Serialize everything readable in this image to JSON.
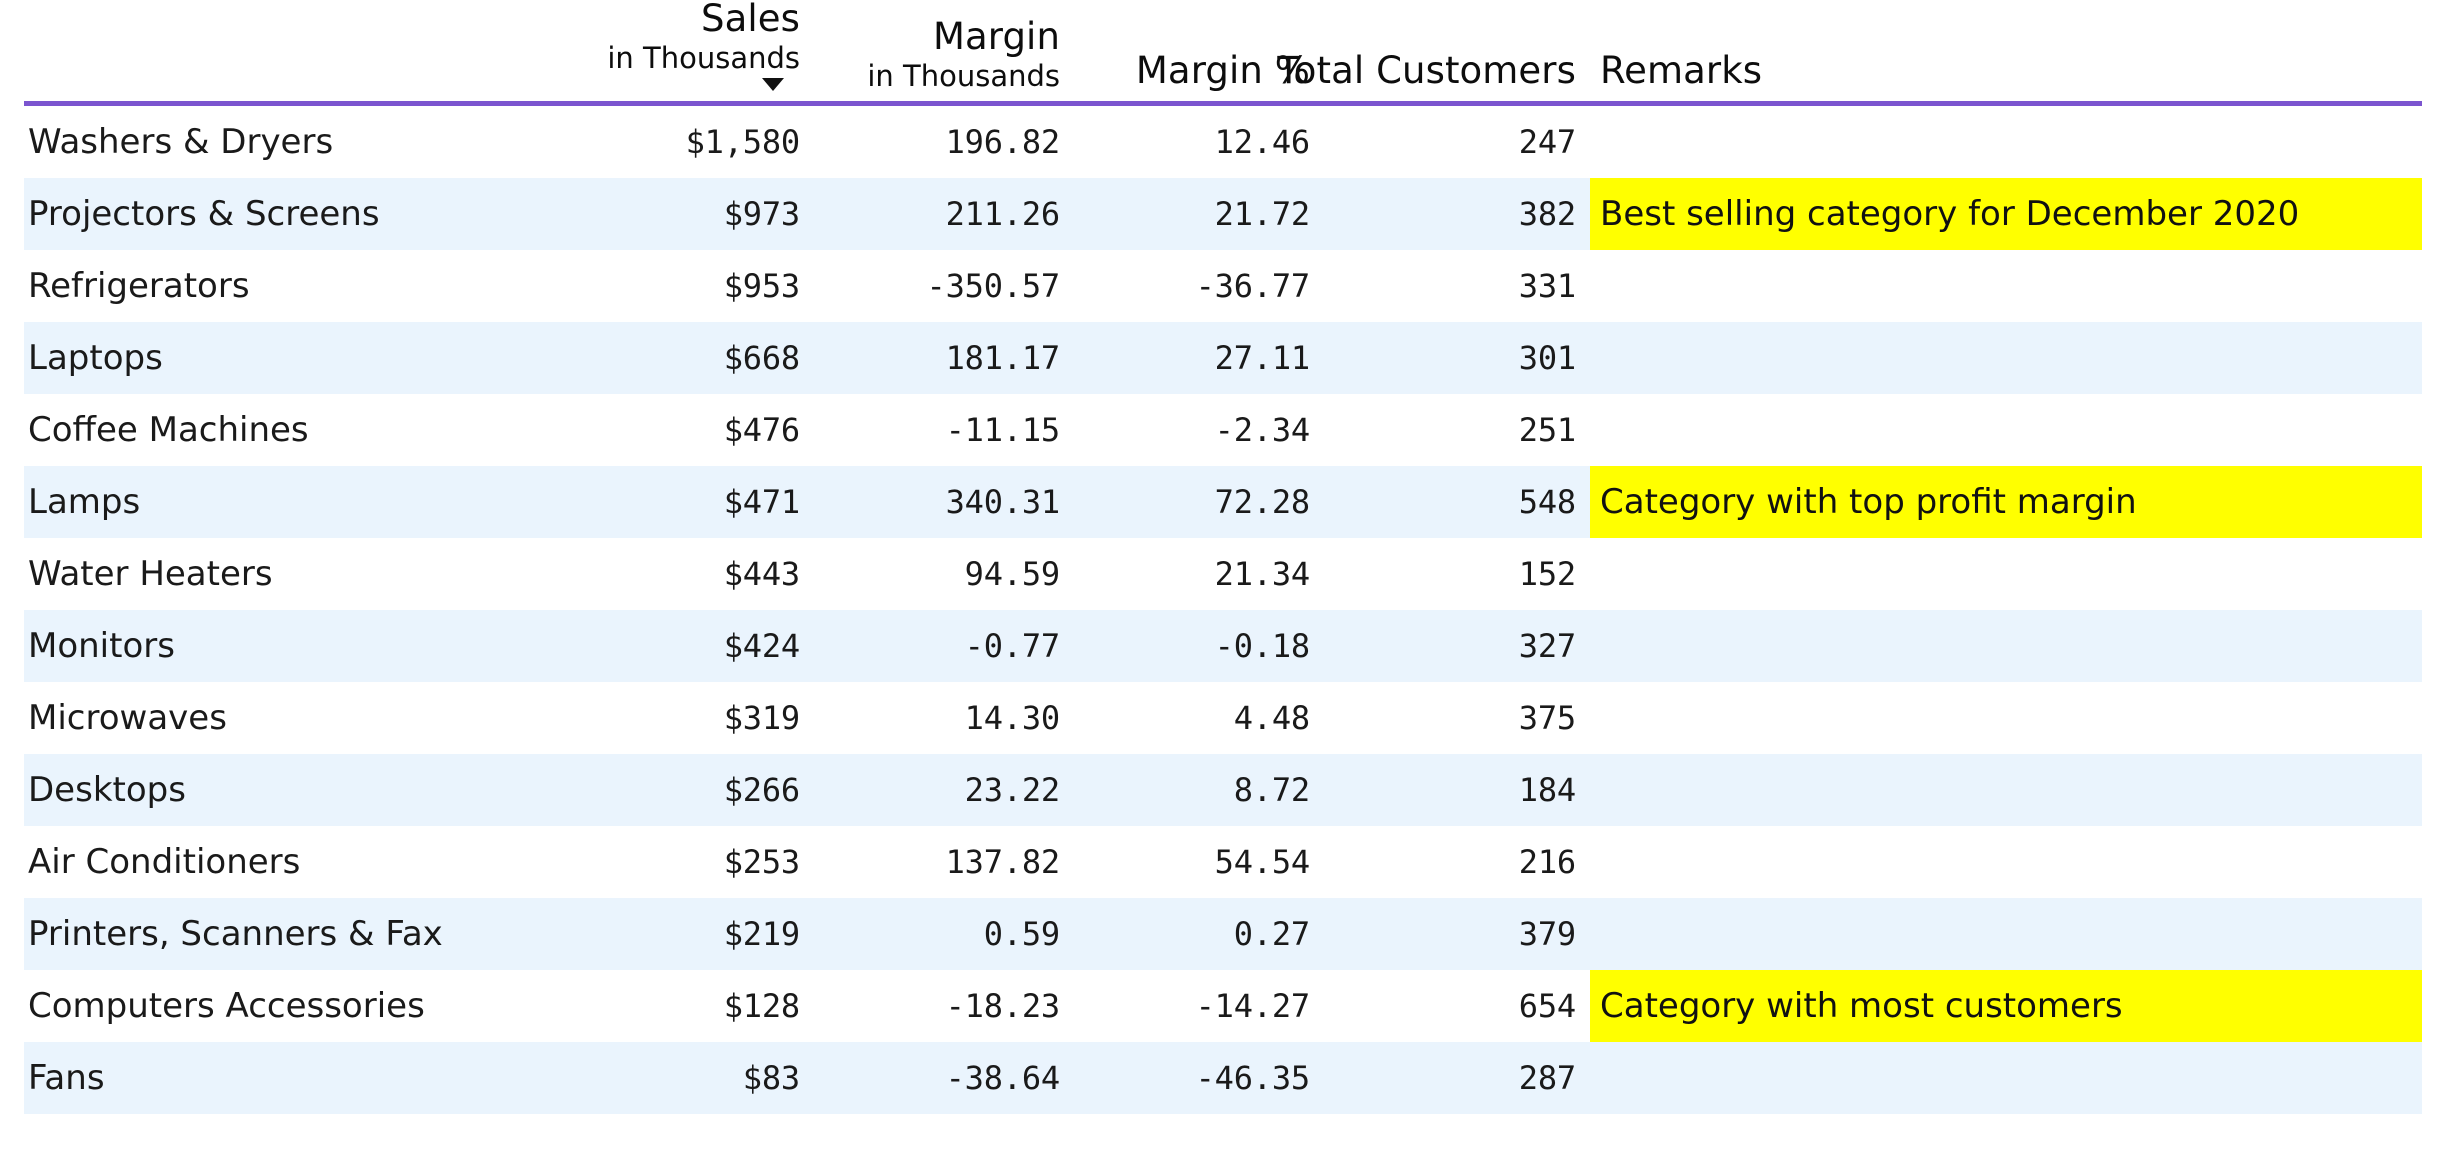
{
  "table": {
    "accent_color": "#7b55cf",
    "stripe_color": "#eaf4fd",
    "highlight_color": "#ffff00",
    "columns": [
      {
        "key": "category",
        "title": "",
        "subtitle": "",
        "align": "left",
        "sorted": false
      },
      {
        "key": "sales",
        "title": "Sales",
        "subtitle": "in Thousands",
        "align": "right",
        "sorted": true,
        "sort_direction": "desc"
      },
      {
        "key": "margin",
        "title": "Margin",
        "subtitle": "in Thousands",
        "align": "right",
        "sorted": false
      },
      {
        "key": "marginpct",
        "title": "Margin %",
        "subtitle": "",
        "align": "right",
        "sorted": false
      },
      {
        "key": "customers",
        "title": "Total Customers",
        "subtitle": "",
        "align": "right",
        "sorted": false
      },
      {
        "key": "remarks",
        "title": "Remarks",
        "subtitle": "",
        "align": "left",
        "sorted": false
      }
    ],
    "rows": [
      {
        "category": "Washers & Dryers",
        "sales": "$1,580",
        "margin": "196.82",
        "marginpct": "12.46",
        "customers": "247",
        "remarks": "",
        "highlighted": false
      },
      {
        "category": "Projectors & Screens",
        "sales": "$973",
        "margin": "211.26",
        "marginpct": "21.72",
        "customers": "382",
        "remarks": "Best selling category for December 2020",
        "highlighted": true
      },
      {
        "category": "Refrigerators",
        "sales": "$953",
        "margin": "-350.57",
        "marginpct": "-36.77",
        "customers": "331",
        "remarks": "",
        "highlighted": false
      },
      {
        "category": "Laptops",
        "sales": "$668",
        "margin": "181.17",
        "marginpct": "27.11",
        "customers": "301",
        "remarks": "",
        "highlighted": false
      },
      {
        "category": "Coffee Machines",
        "sales": "$476",
        "margin": "-11.15",
        "marginpct": "-2.34",
        "customers": "251",
        "remarks": "",
        "highlighted": false
      },
      {
        "category": "Lamps",
        "sales": "$471",
        "margin": "340.31",
        "marginpct": "72.28",
        "customers": "548",
        "remarks": "Category with top profit margin",
        "highlighted": true
      },
      {
        "category": "Water Heaters",
        "sales": "$443",
        "margin": "94.59",
        "marginpct": "21.34",
        "customers": "152",
        "remarks": "",
        "highlighted": false
      },
      {
        "category": "Monitors",
        "sales": "$424",
        "margin": "-0.77",
        "marginpct": "-0.18",
        "customers": "327",
        "remarks": "",
        "highlighted": false
      },
      {
        "category": "Microwaves",
        "sales": "$319",
        "margin": "14.30",
        "marginpct": "4.48",
        "customers": "375",
        "remarks": "",
        "highlighted": false
      },
      {
        "category": "Desktops",
        "sales": "$266",
        "margin": "23.22",
        "marginpct": "8.72",
        "customers": "184",
        "remarks": "",
        "highlighted": false
      },
      {
        "category": "Air Conditioners",
        "sales": "$253",
        "margin": "137.82",
        "marginpct": "54.54",
        "customers": "216",
        "remarks": "",
        "highlighted": false
      },
      {
        "category": "Printers, Scanners & Fax",
        "sales": "$219",
        "margin": "0.59",
        "marginpct": "0.27",
        "customers": "379",
        "remarks": "",
        "highlighted": false
      },
      {
        "category": "Computers Accessories",
        "sales": "$128",
        "margin": "-18.23",
        "marginpct": "-14.27",
        "customers": "654",
        "remarks": "Category with most customers",
        "highlighted": true
      },
      {
        "category": "Fans",
        "sales": "$83",
        "margin": "-38.64",
        "marginpct": "-46.35",
        "customers": "287",
        "remarks": "",
        "highlighted": false
      }
    ]
  },
  "chart_data": {
    "type": "table",
    "title": "",
    "columns": [
      "Category",
      "Sales in Thousands",
      "Margin in Thousands",
      "Margin %",
      "Total Customers",
      "Remarks"
    ],
    "sorted_by": "Sales in Thousands",
    "sort_direction": "descending",
    "categories": [
      "Washers & Dryers",
      "Projectors & Screens",
      "Refrigerators",
      "Laptops",
      "Coffee Machines",
      "Lamps",
      "Water Heaters",
      "Monitors",
      "Microwaves",
      "Desktops",
      "Air Conditioners",
      "Printers, Scanners & Fax",
      "Computers Accessories",
      "Fans"
    ],
    "series": [
      {
        "name": "Sales in Thousands",
        "values": [
          1580,
          973,
          953,
          668,
          476,
          471,
          443,
          424,
          319,
          266,
          253,
          219,
          128,
          83
        ]
      },
      {
        "name": "Margin in Thousands",
        "values": [
          196.82,
          211.26,
          -350.57,
          181.17,
          -11.15,
          340.31,
          94.59,
          -0.77,
          14.3,
          23.22,
          137.82,
          0.59,
          -18.23,
          -38.64
        ]
      },
      {
        "name": "Margin %",
        "values": [
          12.46,
          21.72,
          -36.77,
          27.11,
          -2.34,
          72.28,
          21.34,
          -0.18,
          4.48,
          8.72,
          54.54,
          0.27,
          -14.27,
          -46.35
        ]
      },
      {
        "name": "Total Customers",
        "values": [
          247,
          382,
          331,
          301,
          251,
          548,
          152,
          327,
          375,
          184,
          216,
          379,
          654,
          287
        ]
      }
    ],
    "annotations": [
      {
        "category": "Projectors & Screens",
        "text": "Best selling category for December 2020"
      },
      {
        "category": "Lamps",
        "text": "Category with top profit margin"
      },
      {
        "category": "Computers Accessories",
        "text": "Category with most customers"
      }
    ]
  }
}
